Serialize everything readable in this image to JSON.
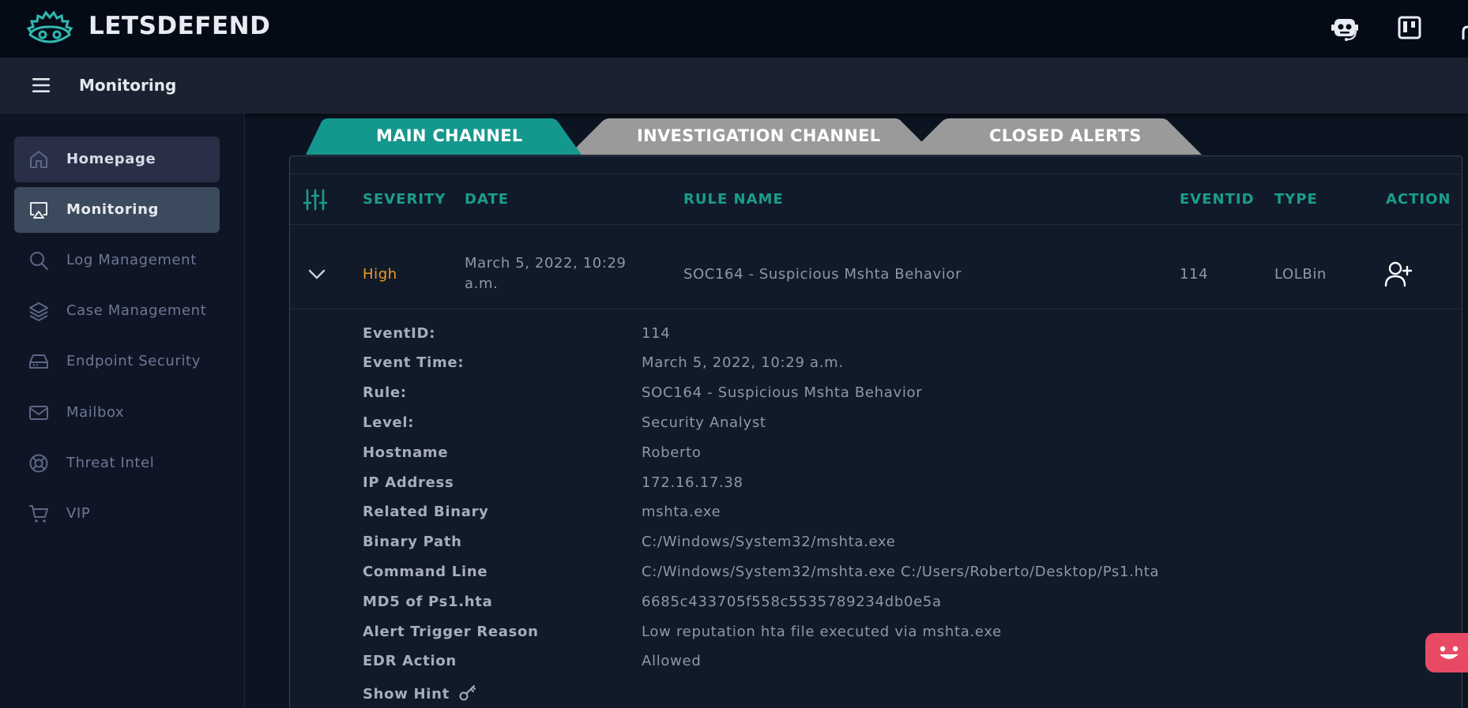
{
  "brand": {
    "name": "LETSDEFEND",
    "accent": "#2fb9b0"
  },
  "topbar": {
    "icons": [
      "robot-icon",
      "kanban-board-icon"
    ]
  },
  "subbar": {
    "title": "Monitoring",
    "menu_icon": "hamburger-icon"
  },
  "sidebar": {
    "items": [
      {
        "label": "Homepage",
        "icon": "home-icon"
      },
      {
        "label": "Monitoring",
        "icon": "monitor-icon"
      },
      {
        "label": "Log Management",
        "icon": "search-icon"
      },
      {
        "label": "Case Management",
        "icon": "layers-icon"
      },
      {
        "label": "Endpoint Security",
        "icon": "hard-drive-icon"
      },
      {
        "label": "Mailbox",
        "icon": "mail-icon"
      },
      {
        "label": "Threat Intel",
        "icon": "lifebuoy-icon"
      },
      {
        "label": "VIP",
        "icon": "cart-icon"
      }
    ]
  },
  "tabs": [
    {
      "label": "MAIN CHANNEL",
      "color": "#14978d"
    },
    {
      "label": "INVESTIGATION CHANNEL",
      "color": "#9a9a9a"
    },
    {
      "label": "CLOSED ALERTS",
      "color": "#9a9a9a"
    }
  ],
  "table": {
    "columns": [
      "SEVERITY",
      "DATE",
      "RULE NAME",
      "EVENTID",
      "TYPE",
      "ACTION"
    ],
    "header_color": "#1a9e8c",
    "row": {
      "severity": "High",
      "severity_color": "#f29a27",
      "date_line1": "March 5, 2022, 10:29",
      "date_line2": "a.m.",
      "rule_name": "SOC164 - Suspicious Mshta Behavior",
      "event_id": "114",
      "type": "LOLBin"
    }
  },
  "details": [
    {
      "label": "EventID:",
      "value": "114"
    },
    {
      "label": "Event Time:",
      "value": "March 5, 2022, 10:29 a.m."
    },
    {
      "label": "Rule:",
      "value": "SOC164 - Suspicious Mshta Behavior"
    },
    {
      "label": "Level:",
      "value": "Security Analyst"
    },
    {
      "label": "Hostname",
      "value": "Roberto"
    },
    {
      "label": "IP Address",
      "value": "172.16.17.38"
    },
    {
      "label": "Related Binary",
      "value": "mshta.exe"
    },
    {
      "label": "Binary Path",
      "value": "C:/Windows/System32/mshta.exe"
    },
    {
      "label": "Command Line",
      "value": "C:/Windows/System32/mshta.exe C:/Users/Roberto/Desktop/Ps1.hta"
    },
    {
      "label": "MD5 of Ps1.hta",
      "value": "6685c433705f558c5535789234db0e5a"
    },
    {
      "label": "Alert Trigger Reason",
      "value": "Low reputation hta file executed via mshta.exe"
    },
    {
      "label": "EDR Action",
      "value": "Allowed"
    }
  ],
  "hint": {
    "label": "Show Hint",
    "icon": "key-icon"
  }
}
